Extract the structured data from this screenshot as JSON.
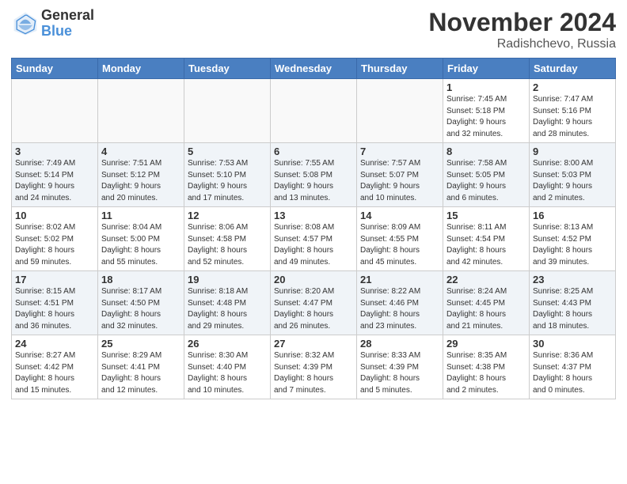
{
  "logo": {
    "general": "General",
    "blue": "Blue"
  },
  "title": "November 2024",
  "location": "Radishchevo, Russia",
  "days_of_week": [
    "Sunday",
    "Monday",
    "Tuesday",
    "Wednesday",
    "Thursday",
    "Friday",
    "Saturday"
  ],
  "weeks": [
    [
      {
        "num": "",
        "info": ""
      },
      {
        "num": "",
        "info": ""
      },
      {
        "num": "",
        "info": ""
      },
      {
        "num": "",
        "info": ""
      },
      {
        "num": "",
        "info": ""
      },
      {
        "num": "1",
        "info": "Sunrise: 7:45 AM\nSunset: 5:18 PM\nDaylight: 9 hours\nand 32 minutes."
      },
      {
        "num": "2",
        "info": "Sunrise: 7:47 AM\nSunset: 5:16 PM\nDaylight: 9 hours\nand 28 minutes."
      }
    ],
    [
      {
        "num": "3",
        "info": "Sunrise: 7:49 AM\nSunset: 5:14 PM\nDaylight: 9 hours\nand 24 minutes."
      },
      {
        "num": "4",
        "info": "Sunrise: 7:51 AM\nSunset: 5:12 PM\nDaylight: 9 hours\nand 20 minutes."
      },
      {
        "num": "5",
        "info": "Sunrise: 7:53 AM\nSunset: 5:10 PM\nDaylight: 9 hours\nand 17 minutes."
      },
      {
        "num": "6",
        "info": "Sunrise: 7:55 AM\nSunset: 5:08 PM\nDaylight: 9 hours\nand 13 minutes."
      },
      {
        "num": "7",
        "info": "Sunrise: 7:57 AM\nSunset: 5:07 PM\nDaylight: 9 hours\nand 10 minutes."
      },
      {
        "num": "8",
        "info": "Sunrise: 7:58 AM\nSunset: 5:05 PM\nDaylight: 9 hours\nand 6 minutes."
      },
      {
        "num": "9",
        "info": "Sunrise: 8:00 AM\nSunset: 5:03 PM\nDaylight: 9 hours\nand 2 minutes."
      }
    ],
    [
      {
        "num": "10",
        "info": "Sunrise: 8:02 AM\nSunset: 5:02 PM\nDaylight: 8 hours\nand 59 minutes."
      },
      {
        "num": "11",
        "info": "Sunrise: 8:04 AM\nSunset: 5:00 PM\nDaylight: 8 hours\nand 55 minutes."
      },
      {
        "num": "12",
        "info": "Sunrise: 8:06 AM\nSunset: 4:58 PM\nDaylight: 8 hours\nand 52 minutes."
      },
      {
        "num": "13",
        "info": "Sunrise: 8:08 AM\nSunset: 4:57 PM\nDaylight: 8 hours\nand 49 minutes."
      },
      {
        "num": "14",
        "info": "Sunrise: 8:09 AM\nSunset: 4:55 PM\nDaylight: 8 hours\nand 45 minutes."
      },
      {
        "num": "15",
        "info": "Sunrise: 8:11 AM\nSunset: 4:54 PM\nDaylight: 8 hours\nand 42 minutes."
      },
      {
        "num": "16",
        "info": "Sunrise: 8:13 AM\nSunset: 4:52 PM\nDaylight: 8 hours\nand 39 minutes."
      }
    ],
    [
      {
        "num": "17",
        "info": "Sunrise: 8:15 AM\nSunset: 4:51 PM\nDaylight: 8 hours\nand 36 minutes."
      },
      {
        "num": "18",
        "info": "Sunrise: 8:17 AM\nSunset: 4:50 PM\nDaylight: 8 hours\nand 32 minutes."
      },
      {
        "num": "19",
        "info": "Sunrise: 8:18 AM\nSunset: 4:48 PM\nDaylight: 8 hours\nand 29 minutes."
      },
      {
        "num": "20",
        "info": "Sunrise: 8:20 AM\nSunset: 4:47 PM\nDaylight: 8 hours\nand 26 minutes."
      },
      {
        "num": "21",
        "info": "Sunrise: 8:22 AM\nSunset: 4:46 PM\nDaylight: 8 hours\nand 23 minutes."
      },
      {
        "num": "22",
        "info": "Sunrise: 8:24 AM\nSunset: 4:45 PM\nDaylight: 8 hours\nand 21 minutes."
      },
      {
        "num": "23",
        "info": "Sunrise: 8:25 AM\nSunset: 4:43 PM\nDaylight: 8 hours\nand 18 minutes."
      }
    ],
    [
      {
        "num": "24",
        "info": "Sunrise: 8:27 AM\nSunset: 4:42 PM\nDaylight: 8 hours\nand 15 minutes."
      },
      {
        "num": "25",
        "info": "Sunrise: 8:29 AM\nSunset: 4:41 PM\nDaylight: 8 hours\nand 12 minutes."
      },
      {
        "num": "26",
        "info": "Sunrise: 8:30 AM\nSunset: 4:40 PM\nDaylight: 8 hours\nand 10 minutes."
      },
      {
        "num": "27",
        "info": "Sunrise: 8:32 AM\nSunset: 4:39 PM\nDaylight: 8 hours\nand 7 minutes."
      },
      {
        "num": "28",
        "info": "Sunrise: 8:33 AM\nSunset: 4:39 PM\nDaylight: 8 hours\nand 5 minutes."
      },
      {
        "num": "29",
        "info": "Sunrise: 8:35 AM\nSunset: 4:38 PM\nDaylight: 8 hours\nand 2 minutes."
      },
      {
        "num": "30",
        "info": "Sunrise: 8:36 AM\nSunset: 4:37 PM\nDaylight: 8 hours\nand 0 minutes."
      }
    ]
  ]
}
